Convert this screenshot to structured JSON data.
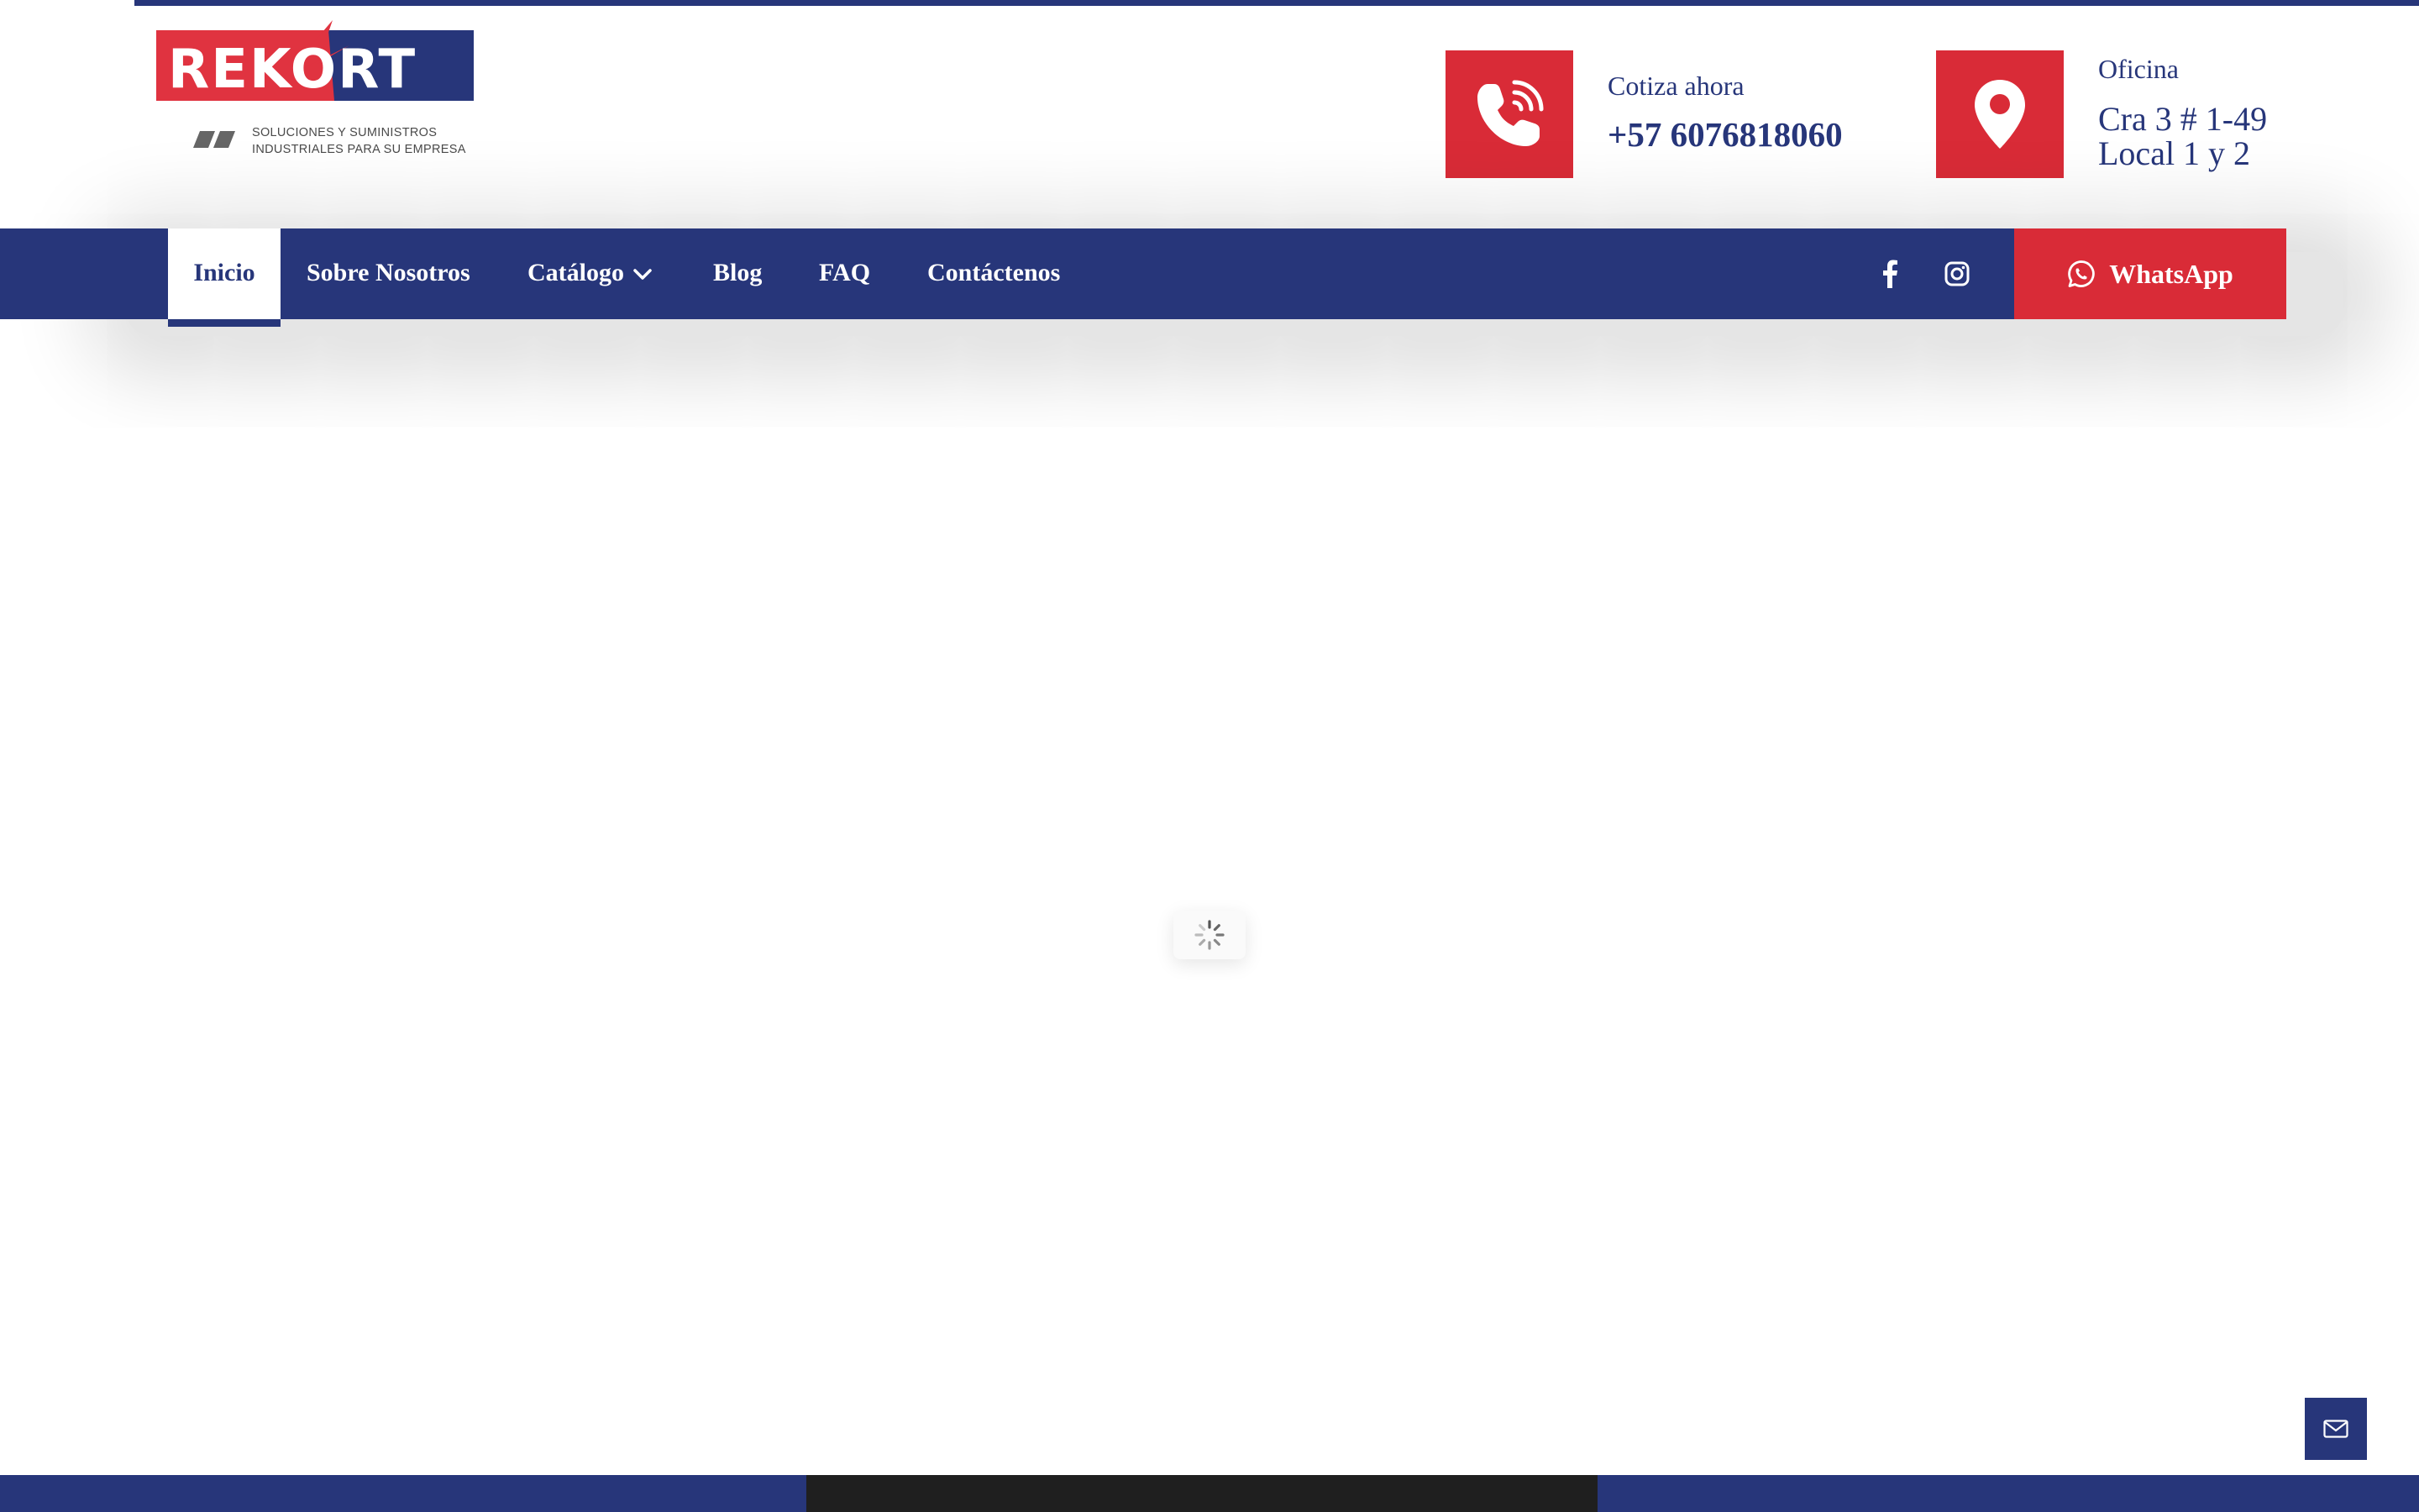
{
  "brand": {
    "logo_text": "REKORT",
    "tagline_line1": "SOLUCIONES Y SUMINISTROS",
    "tagline_line2": "INDUSTRIALES PARA SU EMPRESA",
    "colors": {
      "navy": "#27367a",
      "red": "#d92b37"
    }
  },
  "contact": {
    "phone": {
      "icon": "phone-ringing-icon",
      "label": "Cotiza ahora",
      "value": "+57 6076818060"
    },
    "office": {
      "icon": "map-pin-icon",
      "label": "Oficina",
      "line1": "Cra 3 # 1-49",
      "line2": "Local 1 y 2"
    }
  },
  "nav": {
    "items": [
      {
        "label": "Inicio",
        "active": true
      },
      {
        "label": "Sobre Nosotros"
      },
      {
        "label": "Catálogo",
        "has_dropdown": true
      },
      {
        "label": "Blog"
      },
      {
        "label": "FAQ"
      },
      {
        "label": "Contáctenos"
      }
    ],
    "social": [
      "facebook-icon",
      "instagram-icon"
    ],
    "whatsapp_label": "WhatsApp"
  },
  "main": {
    "state": "loading",
    "spinner_icon": "loading-spinner-icon"
  },
  "floating": {
    "icon": "envelope-icon"
  }
}
